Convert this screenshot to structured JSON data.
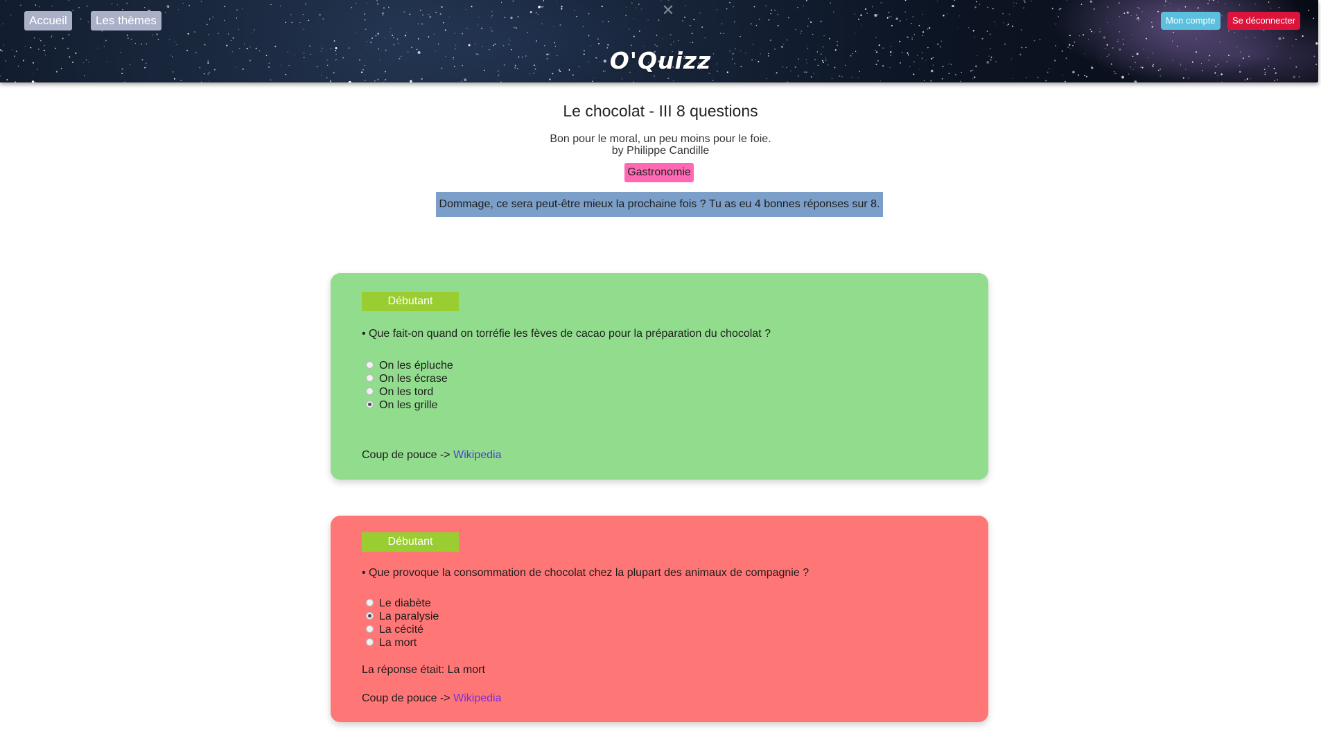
{
  "header": {
    "nav": {
      "home": "Accueil",
      "themes": "Les thèmes"
    },
    "account": {
      "my_account": "Mon compte",
      "logout": "Se déconnecter"
    },
    "logo": "O'Quizz",
    "close_icon": "close-icon",
    "colors": {
      "nav_bg": "#a9b0c8",
      "account_bg": "#5bc0de",
      "logout_bg": "#dc143c"
    }
  },
  "quiz": {
    "title": "Le chocolat - III 8 questions",
    "description": "Bon pour le moral, un peu moins pour le foie.",
    "author": "by Philippe Candille",
    "tag": "Gastronomie",
    "result": "Dommage, ce sera peut-être mieux la prochaine fois ? Tu as eu 4 bonnes réponses sur 8."
  },
  "questions": [
    {
      "status": "correct",
      "color": "#92dc8e",
      "level": "Débutant",
      "text": "• Que fait-on quand on torréfie les fèves de cacao pour la préparation du chocolat ?",
      "answers": [
        "On les épluche",
        "On les écrase",
        "On les tord",
        "On les grille"
      ],
      "selected_index": 3,
      "hint_label": "Coup de pouce ->",
      "hint_link": "Wikipedia"
    },
    {
      "status": "wrong",
      "color": "#ff7676",
      "level": "Débutant",
      "text": "• Que provoque la consommation de chocolat chez la plupart des animaux de compagnie ?",
      "answers": [
        "Le diabète",
        "La paralysie",
        "La cécité",
        "La mort"
      ],
      "selected_index": 1,
      "correct_answer": "La réponse était: La mort",
      "hint_label": "Coup de pouce ->",
      "hint_link": "Wikipedia"
    }
  ]
}
